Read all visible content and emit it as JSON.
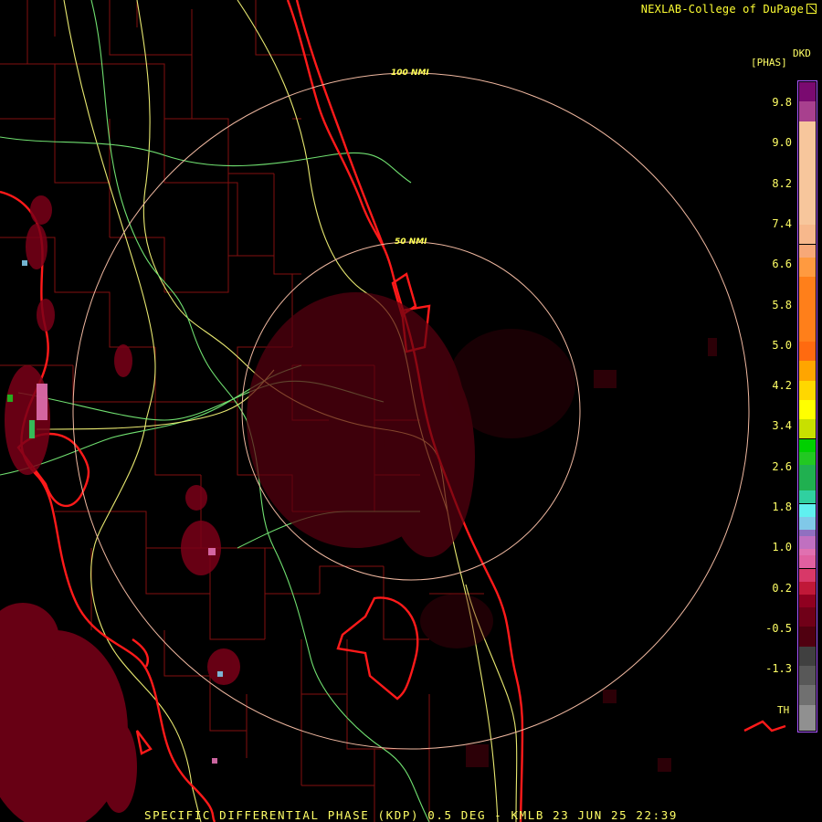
{
  "credit": "NEXLAB-College of DuPage",
  "product_code": "DKD",
  "units": "[PHAS]",
  "ring_labels": [
    "100 NMI",
    "50 NMI"
  ],
  "footer": "SPECIFIC DIFFERENTIAL PHASE (KDP) 0.5 DEG - KMLB 23 JUN 25 22:39",
  "legend": {
    "ticks": [
      "9.8",
      "9.0",
      "8.2",
      "7.4",
      "6.6",
      "5.8",
      "5.0",
      "4.2",
      "3.4",
      "2.6",
      "1.8",
      "1.0",
      "0.2",
      "-0.5",
      "-1.3"
    ],
    "th_label": "TH",
    "colors": [
      "#7a0a70",
      "#a8408e",
      "#f7c69c",
      "#f7b88c",
      "#f7a878",
      "#ff9a40",
      "#ff7f1a",
      "#ff6a10",
      "#ffa500",
      "#ffd700",
      "#ffff00",
      "#c8e000",
      "#00d000",
      "#22c822",
      "#20b050",
      "#30d0a0",
      "#60f0f0",
      "#80c8e8",
      "#9070c0",
      "#c070c0",
      "#e070b0",
      "#e060a0",
      "#d83868",
      "#c01838",
      "#900020",
      "#700018",
      "#500010",
      "#404040",
      "#585858",
      "#707070",
      "#909090"
    ],
    "color_stops": [
      0.0,
      0.03,
      0.06,
      0.22,
      0.25,
      0.27,
      0.3,
      0.4,
      0.43,
      0.46,
      0.49,
      0.52,
      0.55,
      0.57,
      0.59,
      0.63,
      0.65,
      0.67,
      0.69,
      0.7,
      0.72,
      0.73,
      0.75,
      0.77,
      0.79,
      0.81,
      0.84,
      0.87,
      0.9,
      0.93,
      0.96,
      1.0
    ]
  }
}
